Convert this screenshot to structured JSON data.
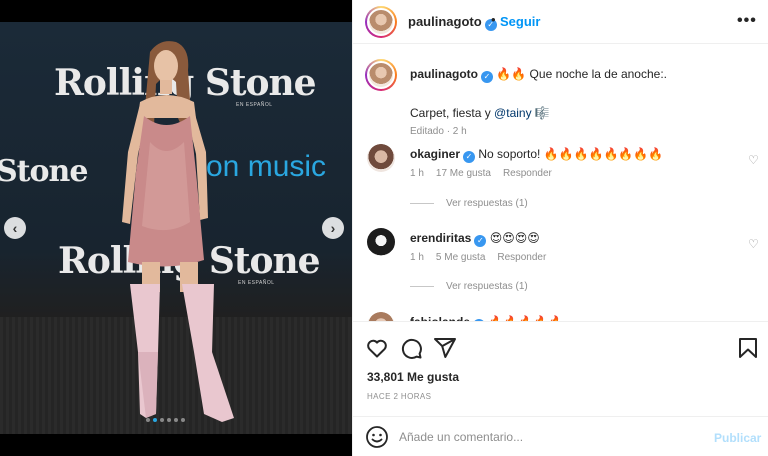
{
  "post": {
    "username": "paulinagoto",
    "separator": "•",
    "follow_label": "Seguir",
    "more_label": "•••"
  },
  "media": {
    "brand_text": "Rolling Stone",
    "brand_partial": "Stone",
    "music_text": "on music",
    "sub_text": "EN ESPAÑOL",
    "prev_label": "‹",
    "next_label": "›",
    "dots_count": 6,
    "active_dot": 1
  },
  "caption": {
    "username": "paulinagoto",
    "text": "🔥🔥 Que noche la de anoche:.",
    "line2_prefix": "Carpet, fiesta y ",
    "mention": "@tainy",
    "line2_emoji": "🎼",
    "meta": "Editado · 2 h"
  },
  "comments": [
    {
      "username": "okaginer",
      "text": "No soporto! 🔥🔥🔥🔥🔥🔥🔥🔥",
      "time": "1 h",
      "likes": "17 Me gusta",
      "reply": "Responder"
    },
    {
      "username": "erendiritas",
      "text": "😍😍😍😍",
      "time": "1 h",
      "likes": "5 Me gusta",
      "reply": "Responder"
    },
    {
      "username": "fabiolande",
      "text": "🔥🔥🔥🔥🔥",
      "time": "",
      "likes": "",
      "reply": ""
    }
  ],
  "view_replies": [
    "Ver respuestas (1)",
    "Ver respuestas (1)"
  ],
  "engagement": {
    "likes_label": "33,801 Me gusta",
    "time_ago": "HACE 2 HORAS"
  },
  "composer": {
    "placeholder": "Añade un comentario...",
    "publish_label": "Publicar"
  },
  "colors": {
    "accent": "#0095f6",
    "publish_disabled": "#b2dffc",
    "verified": "#3897f0",
    "dress": "#c98a8a",
    "boots": "#e9c7cf",
    "music_brand": "#2aa7e0"
  },
  "icons": [
    "verified-icon",
    "heart-icon",
    "comment-icon",
    "share-icon",
    "bookmark-icon",
    "emoji-icon",
    "chevron-left-icon",
    "chevron-right-icon",
    "more-icon"
  ]
}
